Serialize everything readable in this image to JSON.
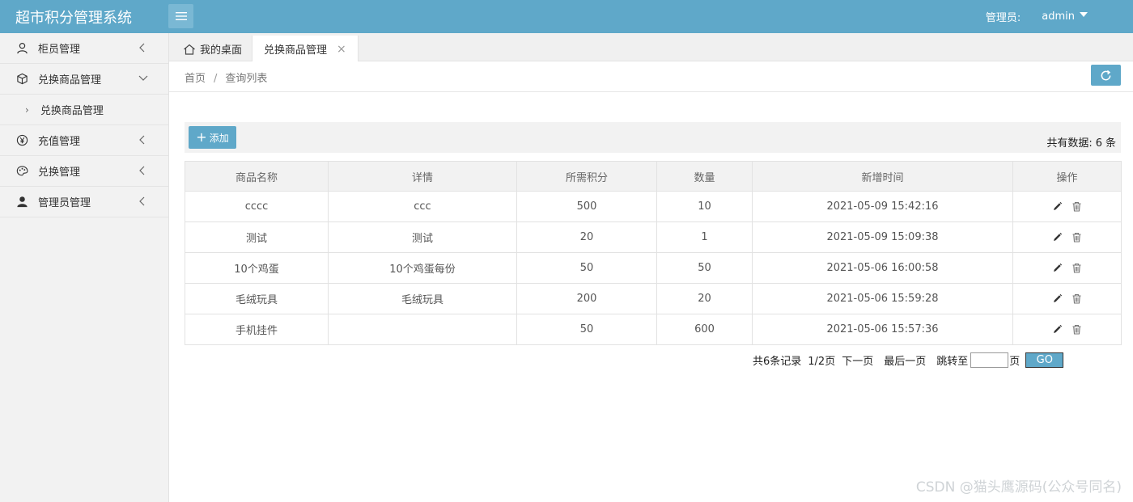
{
  "header": {
    "brand": "超市积分管理系统",
    "role_label": "管理员:",
    "username": "admin"
  },
  "sidebar": {
    "items": [
      {
        "label": "柜员管理",
        "icon": "user-icon"
      },
      {
        "label": "兑换商品管理",
        "icon": "cube-icon",
        "expanded": true,
        "children": [
          {
            "label": "兑换商品管理"
          }
        ]
      },
      {
        "label": "充值管理",
        "icon": "yen-icon"
      },
      {
        "label": "兑换管理",
        "icon": "palette-icon"
      },
      {
        "label": "管理员管理",
        "icon": "person-solid-icon"
      }
    ]
  },
  "tabs": {
    "home": "我的桌面",
    "active": "兑换商品管理"
  },
  "breadcrumb": {
    "home": "首页",
    "separator": "/",
    "current": "查询列表"
  },
  "toolbar": {
    "add_label": "添加",
    "total_prefix": "共有数据:",
    "total_count": "6",
    "total_suffix": "条"
  },
  "table": {
    "columns": [
      "商品名称",
      "详情",
      "所需积分",
      "数量",
      "新增时间",
      "操作"
    ],
    "rows": [
      [
        "cccc",
        "ccc",
        "500",
        "10",
        "2021-05-09 15:42:16"
      ],
      [
        "测试",
        "测试",
        "20",
        "1",
        "2021-05-09 15:09:38"
      ],
      [
        "10个鸡蛋",
        "10个鸡蛋每份",
        "50",
        "50",
        "2021-05-06 16:00:58"
      ],
      [
        "毛绒玩具",
        "毛绒玩具",
        "200",
        "20",
        "2021-05-06 15:59:28"
      ],
      [
        "手机挂件",
        "",
        "50",
        "600",
        "2021-05-06 15:57:36"
      ]
    ]
  },
  "pager": {
    "records": "共6条记录",
    "page_info": "1/2页",
    "next": "下一页",
    "last": "最后一页",
    "jump_prefix": "跳转至",
    "jump_value": "",
    "jump_suffix": "页",
    "go": "GO"
  },
  "watermark": "CSDN @猫头鹰源码(公众号同名)",
  "colors": {
    "accent": "#5fa8c9",
    "sidebar_bg": "#f2f2f2"
  }
}
